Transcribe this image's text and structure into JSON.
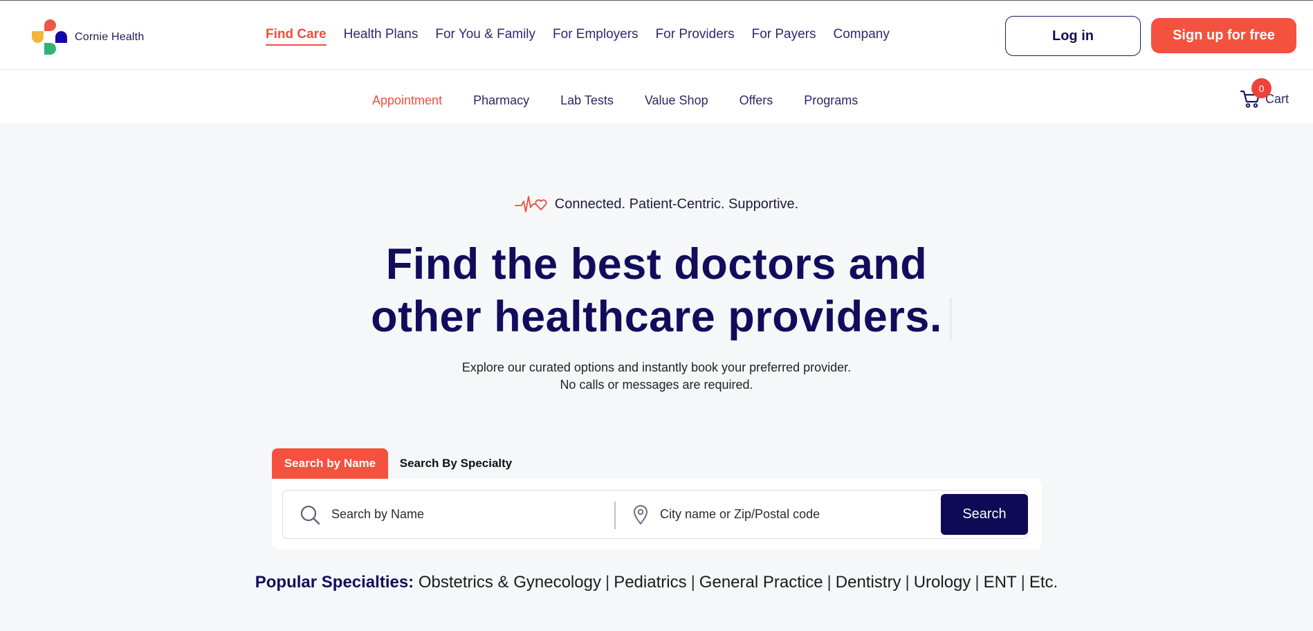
{
  "brand": {
    "name": "Cornie Health"
  },
  "main_nav": {
    "items": [
      {
        "label": "Find Care",
        "active": true
      },
      {
        "label": "Health Plans"
      },
      {
        "label": "For You & Family"
      },
      {
        "label": "For Employers"
      },
      {
        "label": "For Providers"
      },
      {
        "label": "For Payers"
      },
      {
        "label": "Company"
      }
    ],
    "login_label": "Log in",
    "signup_label": "Sign up for free"
  },
  "sub_nav": {
    "items": [
      {
        "label": "Appointment",
        "active": true
      },
      {
        "label": "Pharmacy"
      },
      {
        "label": "Lab Tests"
      },
      {
        "label": "Value Shop"
      },
      {
        "label": "Offers"
      },
      {
        "label": "Programs"
      }
    ],
    "cart_label": "Cart",
    "cart_count": "0"
  },
  "hero": {
    "tagline": "Connected. Patient-Centric. Supportive.",
    "headline_line1": "Find the best doctors and",
    "headline_line2": "other healthcare providers.",
    "sub_line1": "Explore our curated options and instantly book your preferred provider.",
    "sub_line2": "No calls or messages are required."
  },
  "search": {
    "tab_name": "Search by Name",
    "tab_specialty": "Search By Specialty",
    "name_placeholder": "Search by Name",
    "location_placeholder": "City name or Zip/Postal code",
    "button_label": "Search"
  },
  "popular": {
    "label": "Popular Specialties:",
    "items": [
      "Obstetrics & Gynecology",
      "Pediatrics",
      "General Practice",
      "Dentistry",
      "Urology",
      "ENT",
      "Etc."
    ]
  },
  "colors": {
    "accent": "#f4513e",
    "navy": "#110d5c",
    "background": "#f6f7f9"
  }
}
